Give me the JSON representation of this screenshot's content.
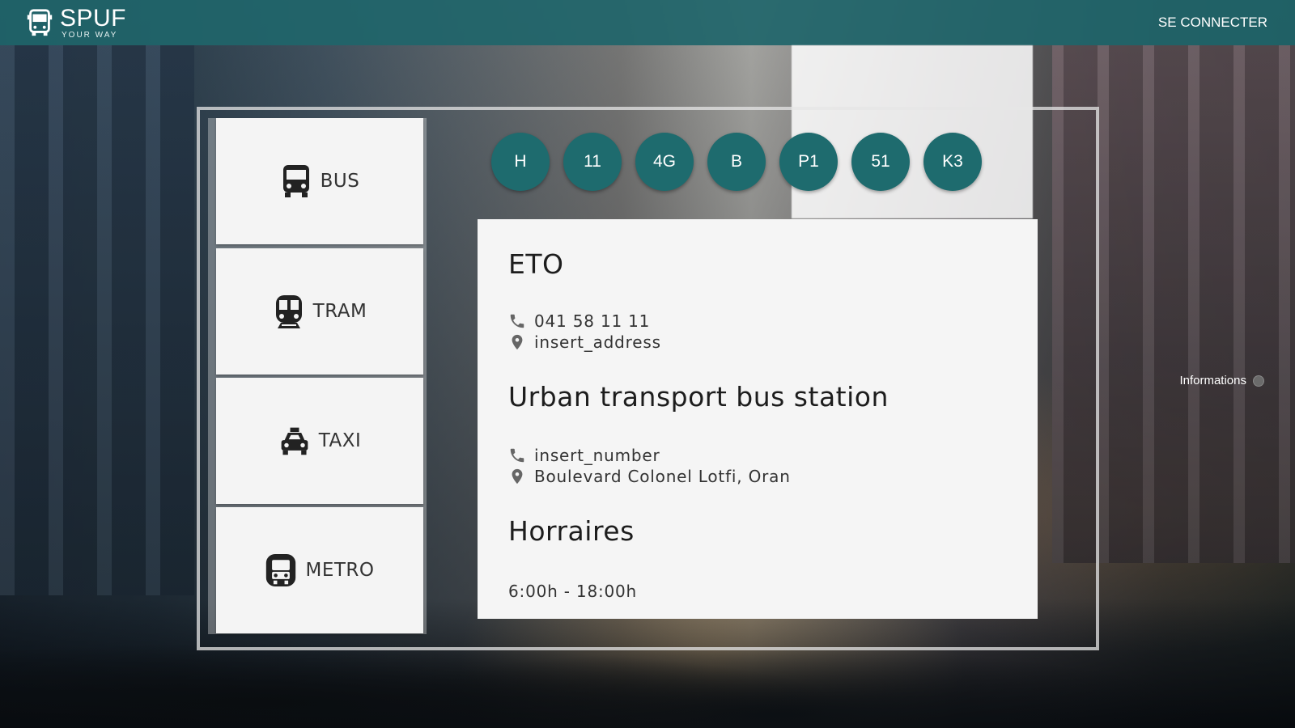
{
  "header": {
    "logo_title": "SPUF",
    "logo_subtitle": "YOUR WAY",
    "login_label": "SE CONNECTER"
  },
  "menu": {
    "items": [
      {
        "label": "BUS",
        "icon": "bus-icon"
      },
      {
        "label": "TRAM",
        "icon": "tram-icon"
      },
      {
        "label": "TAXI",
        "icon": "taxi-icon"
      },
      {
        "label": "METRO",
        "icon": "metro-icon"
      }
    ]
  },
  "lines": [
    "H",
    "11",
    "4G",
    "B",
    "P1",
    "51",
    "K3"
  ],
  "card": {
    "company": "ETO",
    "company_phone": "041 58 11 11",
    "company_address": "insert_address",
    "station_title": "Urban transport bus station",
    "station_phone": "insert_number",
    "station_address": "Boulevard Colonel Lotfi, Oran",
    "hours_title": "Horraires",
    "hours": "6:00h - 18:00h"
  },
  "info_toggle": {
    "label": "Informations"
  },
  "colors": {
    "header": "#1f656a",
    "line_button": "#1e6b6e",
    "card_bg": "#f5f5f5"
  }
}
